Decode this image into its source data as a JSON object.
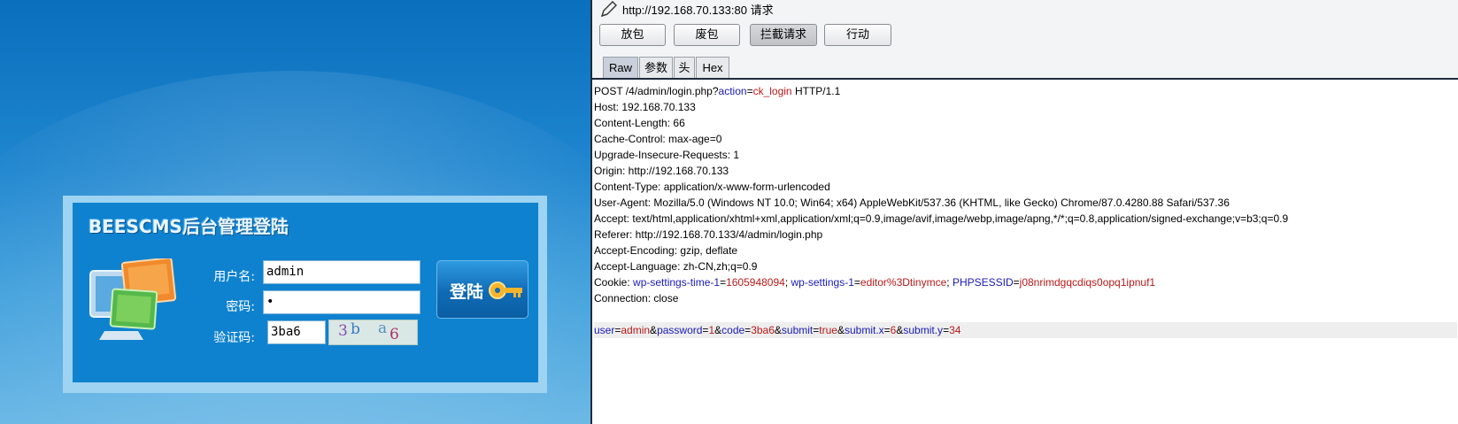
{
  "login": {
    "title": "BEESCMS后台管理登陆",
    "username_label": "用户名:",
    "username_value": "admin",
    "password_label": "密码:",
    "password_value": "•",
    "code_label": "验证码:",
    "code_value": "3ba6",
    "captcha_chars": [
      "3",
      "b",
      "a",
      "6"
    ],
    "submit_label": "登陆"
  },
  "burp": {
    "url": "http://192.168.70.133:80 请求",
    "buttons": [
      "放包",
      "废包",
      "拦截请求",
      "行动"
    ],
    "tabs": [
      "Raw",
      "参数",
      "头",
      "Hex"
    ],
    "request": {
      "line_method_path": "POST /4/admin/login.php?",
      "line_param_key": "action",
      "line_param_val": "ck_login",
      "line_protocol": " HTTP/1.1",
      "headers": [
        "Host: 192.168.70.133",
        "Content-Length: 66",
        "Cache-Control: max-age=0",
        "Upgrade-Insecure-Requests: 1",
        "Origin: http://192.168.70.133",
        "Content-Type: application/x-www-form-urlencoded",
        "User-Agent: Mozilla/5.0 (Windows NT 10.0; Win64; x64) AppleWebKit/537.36 (KHTML, like Gecko) Chrome/87.0.4280.88 Safari/537.36",
        "Accept: text/html,application/xhtml+xml,application/xml;q=0.9,image/avif,image/webp,image/apng,*/*;q=0.8,application/signed-exchange;v=b3;q=0.9",
        "Referer: http://192.168.70.133/4/admin/login.php",
        "Accept-Encoding: gzip, deflate",
        "Accept-Language: zh-CN,zh;q=0.9"
      ],
      "cookie_label": "Cookie: ",
      "cookies": [
        {
          "k": "wp-settings-time-1",
          "v": "1605948094"
        },
        {
          "k": "wp-settings-1",
          "v": "editor%3Dtinymce"
        },
        {
          "k": "PHPSESSID",
          "v": "j08nrimdgqcdiqs0opq1ipnuf1"
        }
      ],
      "connection": "Connection: close",
      "body_params": [
        {
          "k": "user",
          "v": "admin"
        },
        {
          "k": "password",
          "v": "1"
        },
        {
          "k": "code",
          "v": "3ba6"
        },
        {
          "k": "submit",
          "v": "true"
        },
        {
          "k": "submit.x",
          "v": "6"
        },
        {
          "k": "submit.y",
          "v": "34"
        }
      ]
    }
  }
}
